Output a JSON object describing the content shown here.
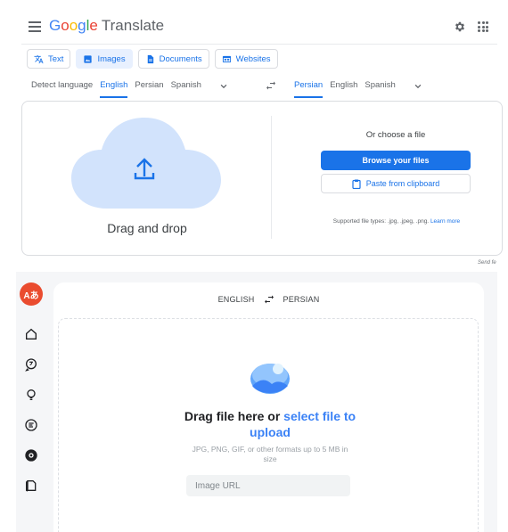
{
  "translate": {
    "logo_letters": [
      "G",
      "o",
      "o",
      "g",
      "l",
      "e"
    ],
    "product": "Translate",
    "icons": {
      "menu": "hamburger-menu-icon",
      "settings": "gear-icon",
      "apps": "apps-grid-icon"
    },
    "modes": [
      {
        "label": "Text",
        "icon": "translate-icon",
        "active": false
      },
      {
        "label": "Images",
        "icon": "image-icon",
        "active": true
      },
      {
        "label": "Documents",
        "icon": "document-icon",
        "active": false
      },
      {
        "label": "Websites",
        "icon": "website-icon",
        "active": false
      }
    ],
    "source_langs": [
      "Detect language",
      "English",
      "Persian",
      "Spanish"
    ],
    "source_selected": "English",
    "target_langs": [
      "Persian",
      "English",
      "Spanish"
    ],
    "target_selected": "Persian",
    "drag_text": "Drag and drop",
    "choose_text": "Or choose a file",
    "browse_label": "Browse your files",
    "paste_label": "Paste from clipboard",
    "supported_text": "Supported file types: .jpg, .jpeg, .png.",
    "learn_more": "Learn more",
    "send_feedback": "Send fe",
    "colors": {
      "accent": "#1a73e8",
      "cloud": "#d2e3fc",
      "selected_bg": "#e8f0fe"
    }
  },
  "app2": {
    "logo_text": "Aあ",
    "rail_icons": [
      "home-icon",
      "chat-translate-icon",
      "lightbulb-icon",
      "text-icon",
      "camera-icon",
      "document-translate-icon"
    ],
    "source_lang": "ENGLISH",
    "target_lang": "PERSIAN",
    "headline_pre": "Drag file here or ",
    "headline_link": "select file to upload",
    "formats_text": "JPG, PNG, GIF, or other formats up to 5 MB in size",
    "url_placeholder": "Image URL",
    "colors": {
      "brand": "#ea4c2f",
      "link": "#3b82f6",
      "rail_bg": "#f5f6f8"
    }
  }
}
